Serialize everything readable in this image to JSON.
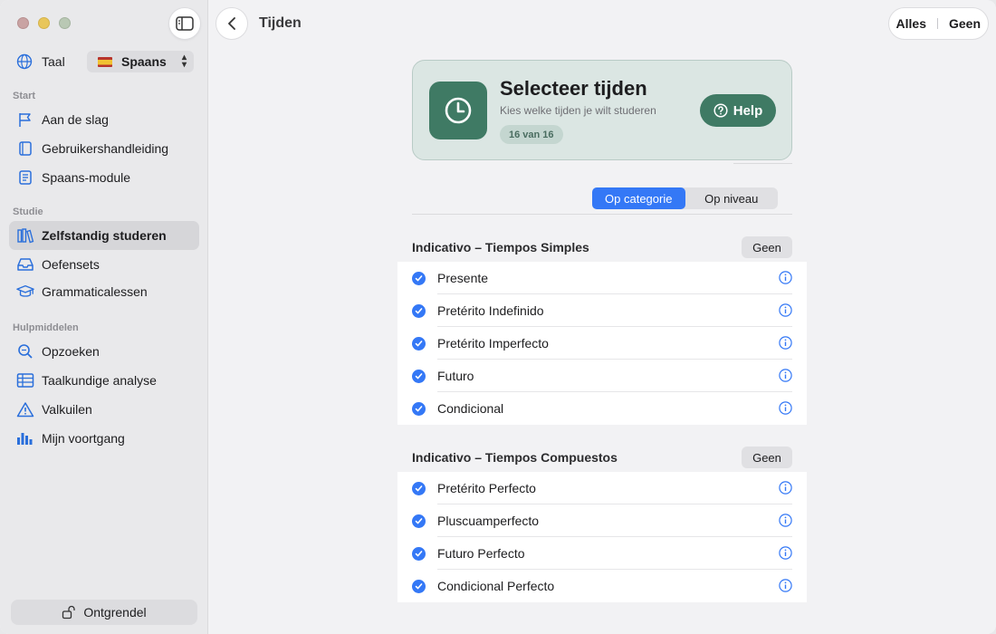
{
  "sidebar": {
    "language_label": "Taal",
    "language_value": "Spaans",
    "sections": {
      "start": "Start",
      "studie": "Studie",
      "hulp": "Hulpmiddelen"
    },
    "items": [
      {
        "label": "Aan de slag",
        "icon": "flag-icon"
      },
      {
        "label": "Gebruikershandleiding",
        "icon": "book-icon"
      },
      {
        "label": "Spaans-module",
        "icon": "module-icon"
      },
      {
        "label": "Zelfstandig studeren",
        "icon": "books-icon"
      },
      {
        "label": "Oefensets",
        "icon": "tray-icon"
      },
      {
        "label": "Grammaticalessen",
        "icon": "graduation-cap-icon"
      },
      {
        "label": "Opzoeken",
        "icon": "magnifier-icon"
      },
      {
        "label": "Taalkundige analyse",
        "icon": "table-icon"
      },
      {
        "label": "Valkuilen",
        "icon": "warning-icon"
      },
      {
        "label": "Mijn voortgang",
        "icon": "bar-chart-icon"
      }
    ],
    "unlock_label": "Ontgrendel"
  },
  "toolbar": {
    "title": "Tijden",
    "all_label": "Alles",
    "none_label": "Geen"
  },
  "header": {
    "title": "Selecteer tijden",
    "subtitle": "Kies welke tijden je wilt studeren",
    "badge": "16 van 16",
    "help_label": "Help"
  },
  "mode": {
    "by_category": "Op categorie",
    "by_level": "Op niveau"
  },
  "groups": [
    {
      "title": "Indicativo – Tiempos Simples",
      "button": "Geen",
      "items": [
        "Presente",
        "Pretérito Indefinido",
        "Pretérito Imperfecto",
        "Futuro",
        "Condicional"
      ]
    },
    {
      "title": "Indicativo – Tiempos Compuestos",
      "button": "Geen",
      "items": [
        "Pretérito Perfecto",
        "Pluscuamperfecto",
        "Futuro Perfecto",
        "Condicional Perfecto"
      ]
    }
  ],
  "colors": {
    "accent": "#3478f6",
    "brand_green": "#3f7a64"
  }
}
